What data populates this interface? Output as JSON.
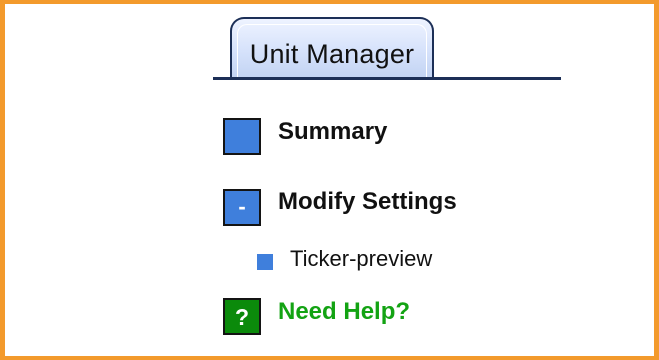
{
  "tab": {
    "label": "Unit Manager"
  },
  "menu": {
    "summary": {
      "label": "Summary",
      "icon": "blue-square-icon"
    },
    "modify_settings": {
      "label": "Modify Settings",
      "icon": "collapse-minus-icon",
      "glyph": "-",
      "children": [
        {
          "label": "Ticker-preview",
          "icon": "blue-bullet-icon"
        }
      ]
    },
    "need_help": {
      "label": "Need Help?",
      "icon": "help-question-icon",
      "glyph": "?"
    }
  },
  "colors": {
    "frame_border": "#f39a2c",
    "tab_outline": "#1c2f57",
    "icon_blue": "#3f7fdc",
    "help_green": "#13a313",
    "help_icon_bg": "#0b8a0b"
  }
}
